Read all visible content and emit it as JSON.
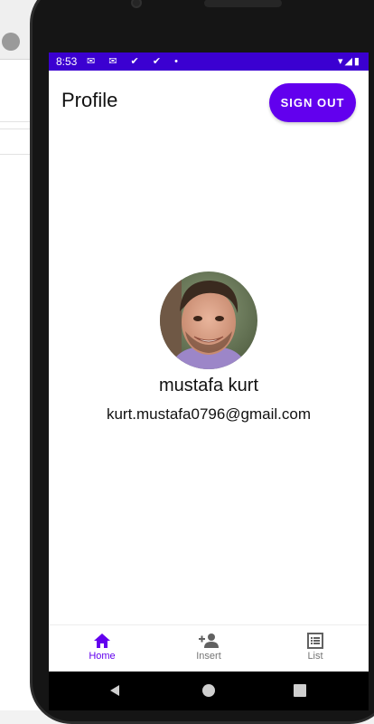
{
  "status_bar": {
    "time": "8:53",
    "notification_icons": "✉ ✉ ✔ ✔ •",
    "system_icons": "▾◢▮"
  },
  "app_bar": {
    "title": "Profile",
    "sign_out_label": "SIGN OUT"
  },
  "profile": {
    "name": "mustafa kurt",
    "email": "kurt.mustafa0796@gmail.com"
  },
  "bottom_nav": {
    "items": [
      {
        "label": "Home",
        "icon": "home-icon",
        "active": true
      },
      {
        "label": "Insert",
        "icon": "person-add-icon",
        "active": false
      },
      {
        "label": "List",
        "icon": "list-icon",
        "active": false
      }
    ]
  },
  "colors": {
    "status_bar": "#3b00d1",
    "primary": "#6200ee"
  }
}
